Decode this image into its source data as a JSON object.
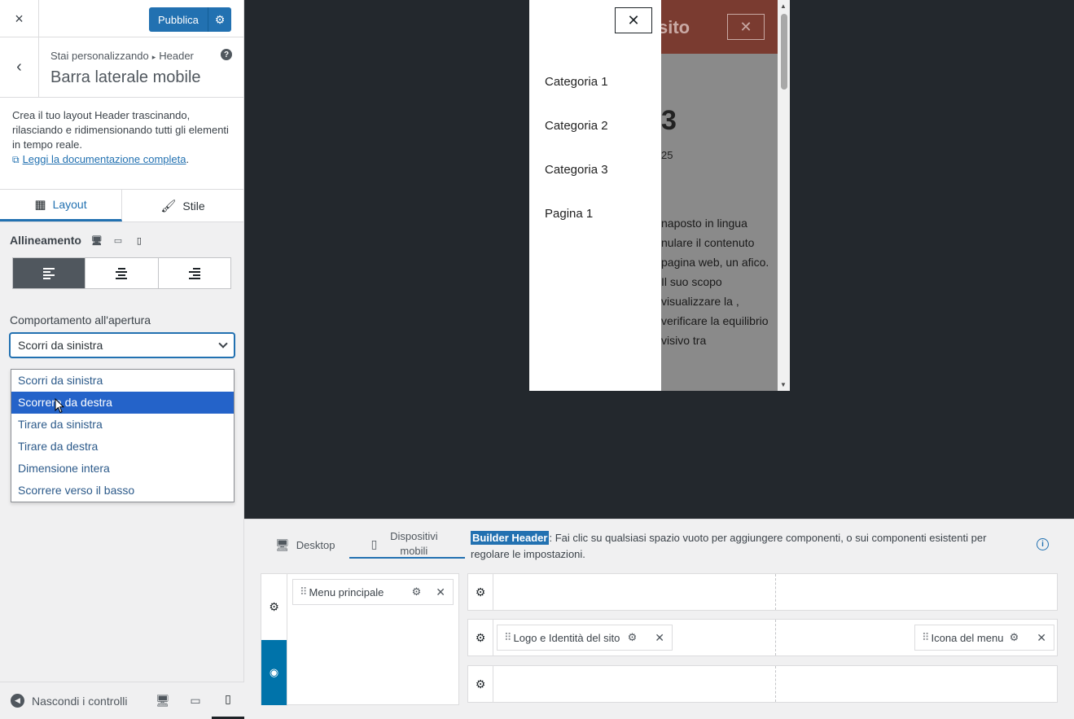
{
  "topbar": {
    "close_label": "×",
    "publish_label": "Pubblica"
  },
  "breadcrumb": {
    "prefix": "Stai personalizzando",
    "parent": "Header",
    "title": "Barra laterale mobile"
  },
  "description": {
    "text": "Crea il tuo layout Header trascinando, rilasciando e ridimensionando tutti gli elementi in tempo reale.",
    "link": "Leggi la documentazione completa",
    "suffix": "."
  },
  "tabs": [
    {
      "label": "Layout",
      "active": true
    },
    {
      "label": "Stile",
      "active": false
    }
  ],
  "alignment": {
    "label": "Allineamento",
    "selected": "left",
    "devices": [
      "desktop",
      "tablet",
      "mobile"
    ],
    "active_device": "mobile"
  },
  "open_behavior": {
    "label": "Comportamento all'apertura",
    "selected": "Scorri da sinistra",
    "options": [
      "Scorri da sinistra",
      "Scorrere da destra",
      "Tirare da sinistra",
      "Tirare da destra",
      "Dimensione intera",
      "Scorrere verso il basso"
    ],
    "highlighted_index": 1
  },
  "footer": {
    "hide_controls": "Nascondi i controlli",
    "active_device": "mobile"
  },
  "preview": {
    "drawer_items": [
      "Categoria 1",
      "Categoria 2",
      "Categoria 3",
      "Pagina 1"
    ],
    "site_title_fragment": "sito",
    "heading_fragment": "3",
    "date_fragment": "25",
    "paragraph_fragment": "naposto in lingua nulare il contenuto pagina web, un afico. Il suo scopo visualizzare la , verificare la equilibrio visivo tra"
  },
  "builder": {
    "tabs": [
      {
        "label": "Desktop",
        "active": false
      },
      {
        "label": "Dispositivi mobili",
        "active": true
      }
    ],
    "info_tag": "Builder Header",
    "info_text": ": Fai clic su qualsiasi spazio vuoto per aggiungere componenti, o sui componenti esistenti per regolare le impostazioni.",
    "offcanvas_item": "Menu principale",
    "row_items": {
      "logo": "Logo e Identità del sito",
      "menu_icon": "Icona del menu"
    }
  },
  "colors": {
    "accent": "#2271b1",
    "highlight": "#2463c9",
    "header_bg": "#7a3b30"
  }
}
